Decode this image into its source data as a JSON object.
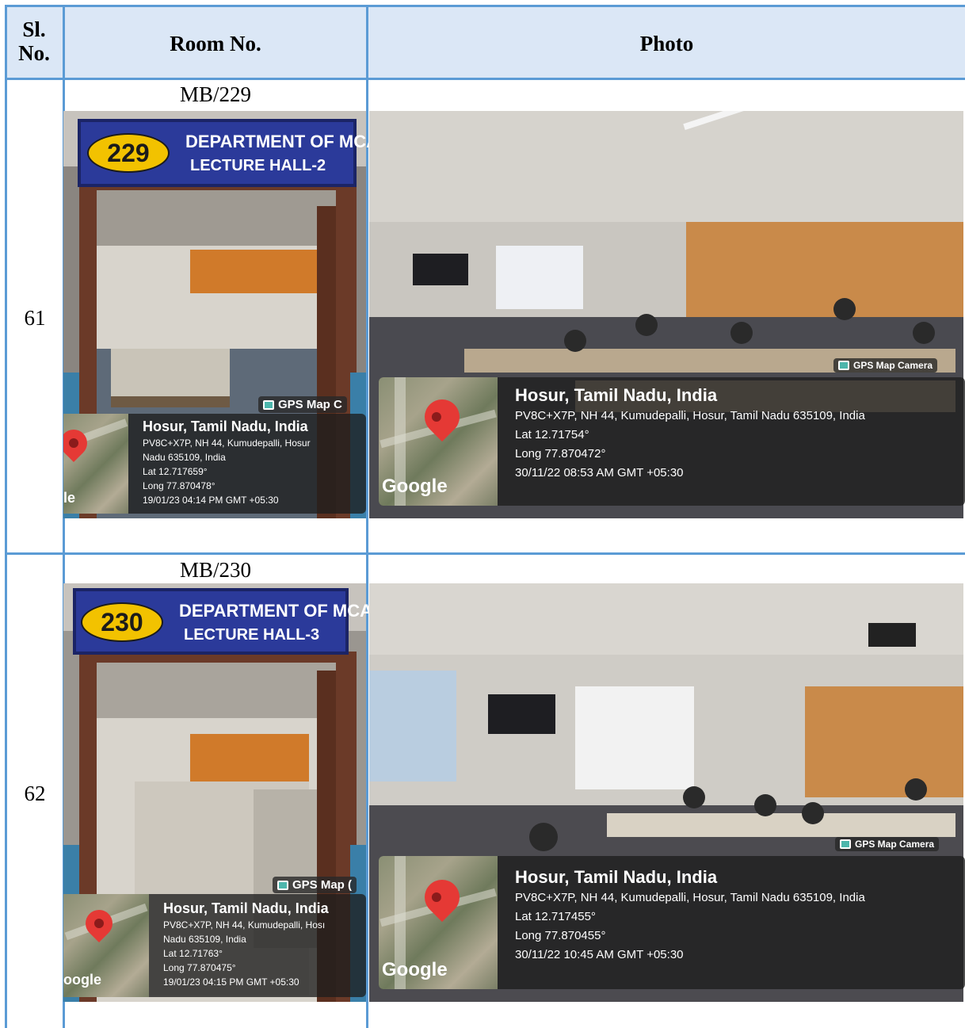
{
  "table": {
    "headers": {
      "sl_no": "Sl. No.",
      "room_no": "Room No.",
      "photo": "Photo"
    },
    "rows": [
      {
        "sl_no": "61",
        "room_no": "MB/229",
        "door_sign": {
          "number": "229",
          "line1": "DEPARTMENT OF MCA",
          "line2": "LECTURE   HALL-2"
        },
        "door_gps": {
          "label": "GPS Map C",
          "city": "Hosur, Tamil Nadu, India",
          "address1": "PV8C+X7P, NH 44, Kumudepalli, Hosur",
          "address2": "Nadu 635109, India",
          "lat": "Lat 12.717659°",
          "long": "Long 77.870478°",
          "datetime": "19/01/23 04:14 PM GMT +05:30",
          "google": "le"
        },
        "class_gps": {
          "label": "GPS Map Camera",
          "city": "Hosur, Tamil Nadu, India",
          "address": "PV8C+X7P, NH 44, Kumudepalli, Hosur, Tamil Nadu 635109, India",
          "lat": "Lat 12.71754°",
          "long": "Long 77.870472°",
          "datetime": "30/11/22 08:53 AM GMT +05:30",
          "google": "Google"
        }
      },
      {
        "sl_no": "62",
        "room_no": "MB/230",
        "door_sign": {
          "number": "230",
          "line1": "DEPARTMENT OF MCA",
          "line2": "LECTURE   HALL-3"
        },
        "door_gps": {
          "label": "GPS Map (",
          "city": "Hosur, Tamil Nadu, India",
          "address1": "PV8C+X7P, NH 44, Kumudepalli, Hosı",
          "address2": "Nadu 635109, India",
          "lat": "Lat 12.71763°",
          "long": "Long 77.870475°",
          "datetime": "19/01/23 04:15 PM GMT +05:30",
          "google": "oogle"
        },
        "class_gps": {
          "label": "GPS Map Camera",
          "city": "Hosur, Tamil Nadu, India",
          "address": "PV8C+X7P, NH 44, Kumudepalli, Hosur, Tamil Nadu 635109, India",
          "lat": "Lat 12.717455°",
          "long": "Long 77.870455°",
          "datetime": "30/11/22 10:45 AM GMT +05:30",
          "google": "Google"
        }
      }
    ]
  },
  "colors": {
    "grid": "#5b9bd5",
    "header_bg": "#dbe7f6",
    "sign_blue": "#2b3a9a",
    "sign_yellow": "#f2c200",
    "pin_red": "#e53935"
  }
}
